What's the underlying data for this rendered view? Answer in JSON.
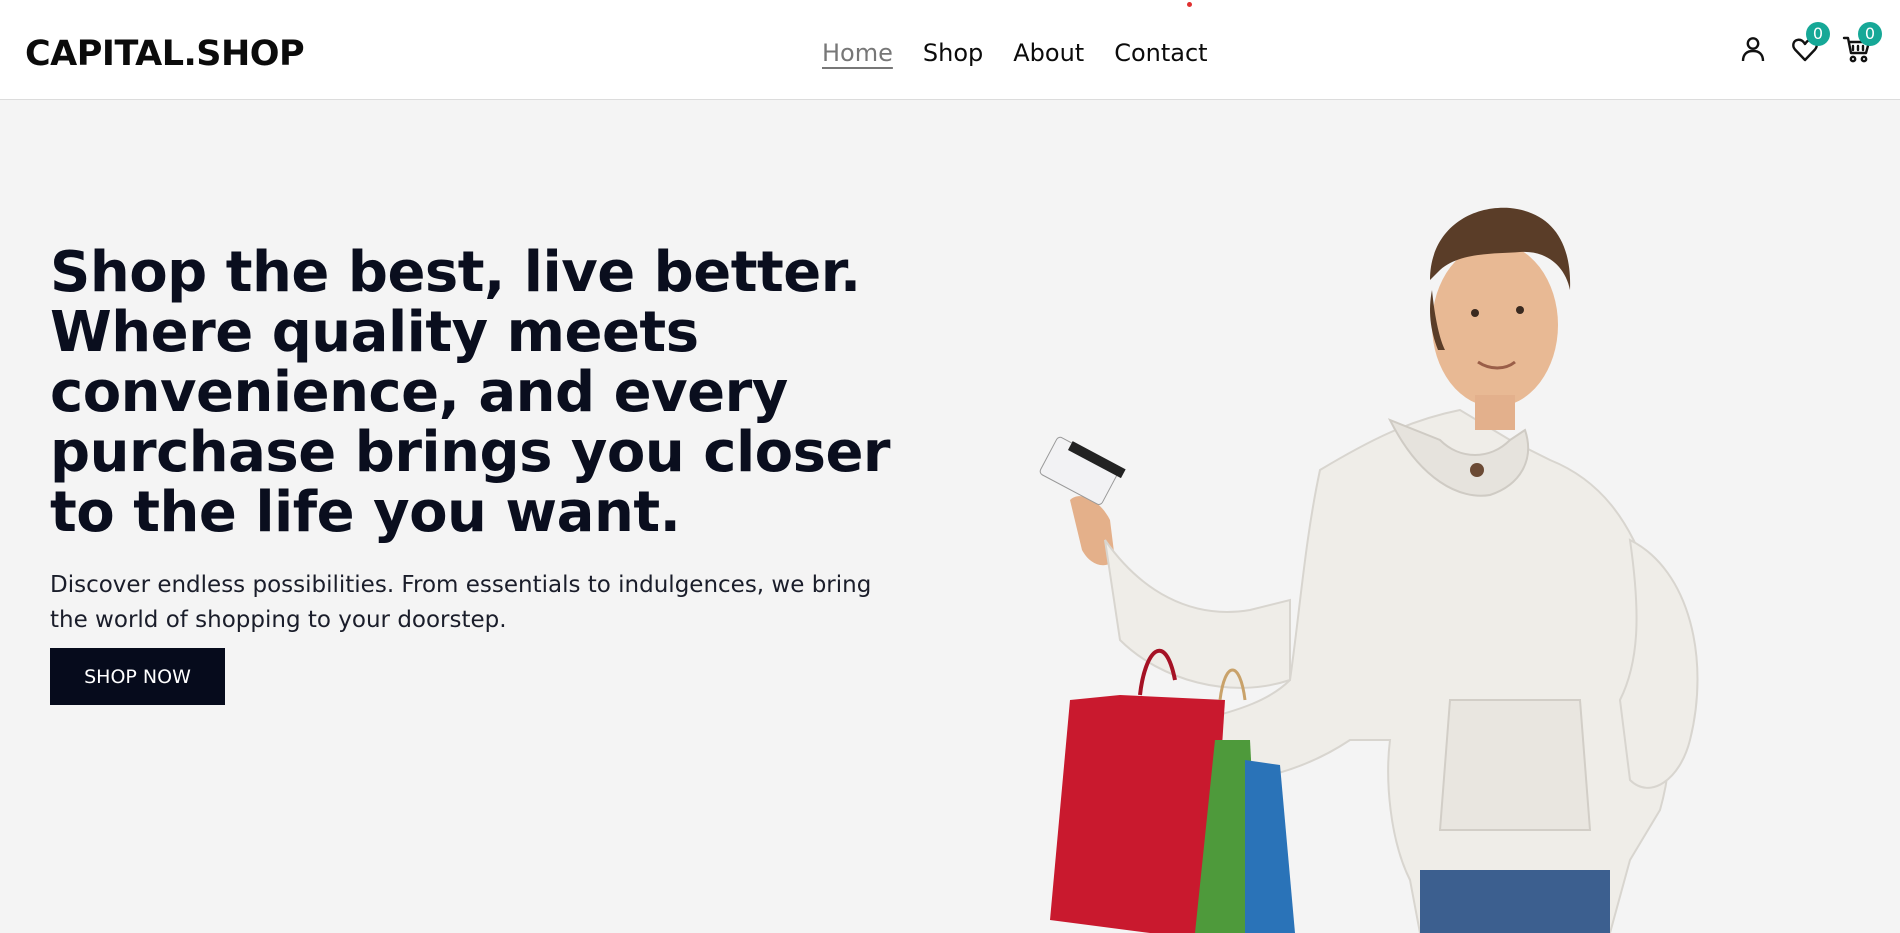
{
  "header": {
    "logo": "CAPITAL.SHOP",
    "nav": [
      {
        "label": "Home",
        "active": true
      },
      {
        "label": "Shop",
        "active": false
      },
      {
        "label": "About",
        "active": false
      },
      {
        "label": "Contact",
        "active": false
      }
    ],
    "icons": {
      "account": "user-icon",
      "wishlist": "heart-icon",
      "cart": "cart-icon"
    },
    "wishlist_count": "0",
    "cart_count": "0"
  },
  "hero": {
    "title": "Shop the best, live better. Where quality meets convenience, and every purchase brings you closer to the life you want.",
    "subtitle": "Discover endless possibilities. From essentials to indulgences, we bring the world of shopping to your doorstep.",
    "cta_label": "SHOP NOW"
  },
  "colors": {
    "background": "#f4f4f4",
    "header_bg": "#ffffff",
    "text_dark": "#0a0e1e",
    "button_bg": "#060b1c",
    "badge_bg": "#16a897"
  }
}
